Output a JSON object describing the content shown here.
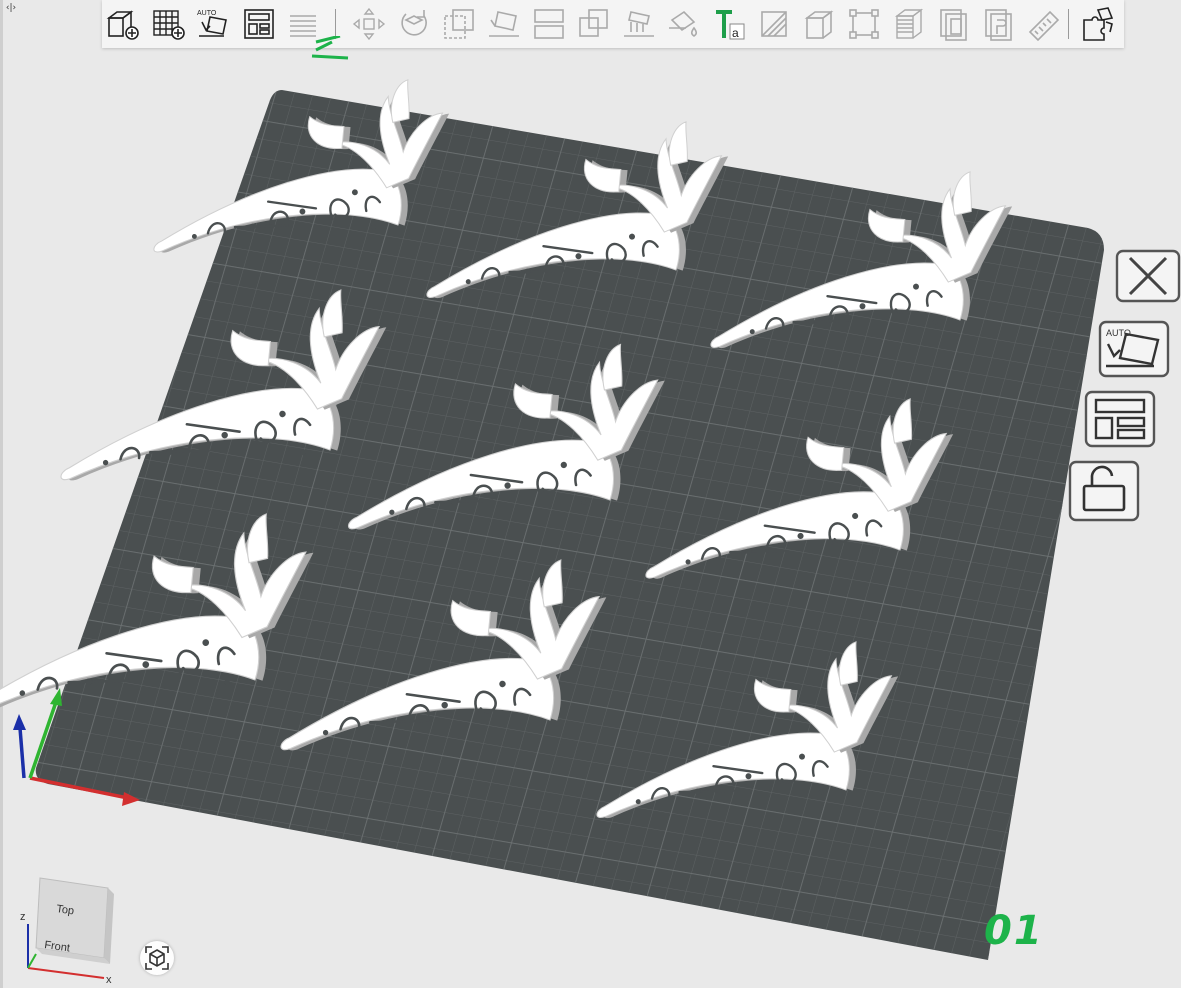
{
  "toolbar": {
    "icons": [
      "add-shape-icon",
      "add-grid-icon",
      "auto-orient-icon",
      "auto-layout-icon",
      "layers-icon",
      "move-icon",
      "rotate-icon",
      "scale-icon",
      "lay-flat-icon",
      "split-icon",
      "boolean-icon",
      "support-icon",
      "paint-icon",
      "text-icon",
      "variable-layer-icon",
      "cube-icon",
      "resize-box-icon",
      "slice-stack-icon",
      "mesh-boolean-icon",
      "assembly-icon",
      "measure-icon",
      "arrange-puzzle-icon"
    ],
    "collapse_symbol": "‹|›"
  },
  "side_panel": {
    "buttons": [
      "close-icon",
      "auto-orient-icon",
      "arrange-icon",
      "unlock-icon"
    ]
  },
  "plate": {
    "label": "01",
    "label_color": "#1db34a",
    "surface_color": "#4a4f50",
    "object_color": "#ffffff",
    "object_count": 9,
    "object_name": "carrot"
  },
  "view_cube": {
    "top_label": "Top",
    "front_label": "Front",
    "axis_z": "z",
    "axis_x": "x"
  },
  "colors": {
    "axis_x": "#d32f2f",
    "axis_y": "#2fb531",
    "axis_z": "#1b2fa8",
    "toolbar_bg": "#f4f4f4",
    "background": "#e9e9e9"
  }
}
